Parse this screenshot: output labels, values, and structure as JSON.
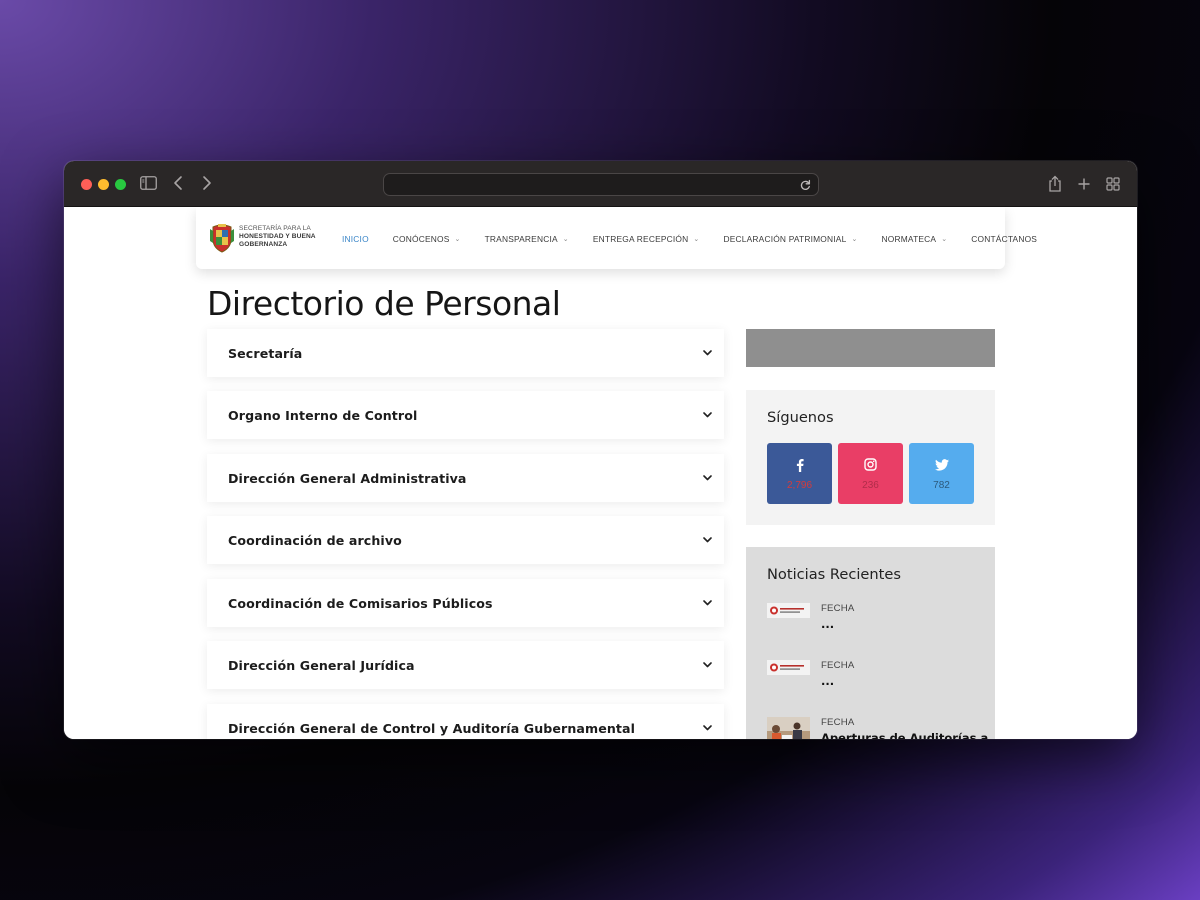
{
  "browser": {
    "url": ""
  },
  "site": {
    "logo_lines": [
      "SECRETARÍA PARA LA",
      "HONESTIDAD Y BUENA",
      "GOBERNANZA"
    ],
    "nav": [
      {
        "label": "INICIO",
        "active": true,
        "has_dropdown": false
      },
      {
        "label": "CONÓCENOS",
        "has_dropdown": true
      },
      {
        "label": "TRANSPARENCIA",
        "has_dropdown": true
      },
      {
        "label": "ENTREGA RECEPCIÓN",
        "has_dropdown": true
      },
      {
        "label": "DECLARACIÓN PATRIMONIAL",
        "has_dropdown": true
      },
      {
        "label": "NORMATECA",
        "has_dropdown": true
      },
      {
        "label": "CONTÁCTANOS",
        "has_dropdown": false
      }
    ]
  },
  "page": {
    "title": "Directorio de Personal",
    "accordion": [
      "Secretaría",
      "Organo Interno de Control",
      "Dirección General Administrativa",
      "Coordinación de archivo",
      "Coordinación de Comisarios Públicos",
      "Dirección General Jurídica",
      "Dirección General de Control y Auditoría Gubernamental"
    ]
  },
  "sidebar": {
    "follow": {
      "title": "Síguenos",
      "facebook": {
        "icon": "facebook-icon",
        "count": "2,796",
        "color": "#3b5998"
      },
      "instagram": {
        "icon": "instagram-icon",
        "count": "236",
        "color": "#e93e66"
      },
      "twitter": {
        "icon": "twitter-icon",
        "count": "782",
        "color": "#55acee"
      }
    },
    "news": {
      "title": "Noticias Recientes",
      "items": [
        {
          "date": "FECHA",
          "title": "..."
        },
        {
          "date": "FECHA",
          "title": "..."
        },
        {
          "date": "FECHA",
          "title": "Aperturas de Auditorías a"
        }
      ]
    }
  }
}
